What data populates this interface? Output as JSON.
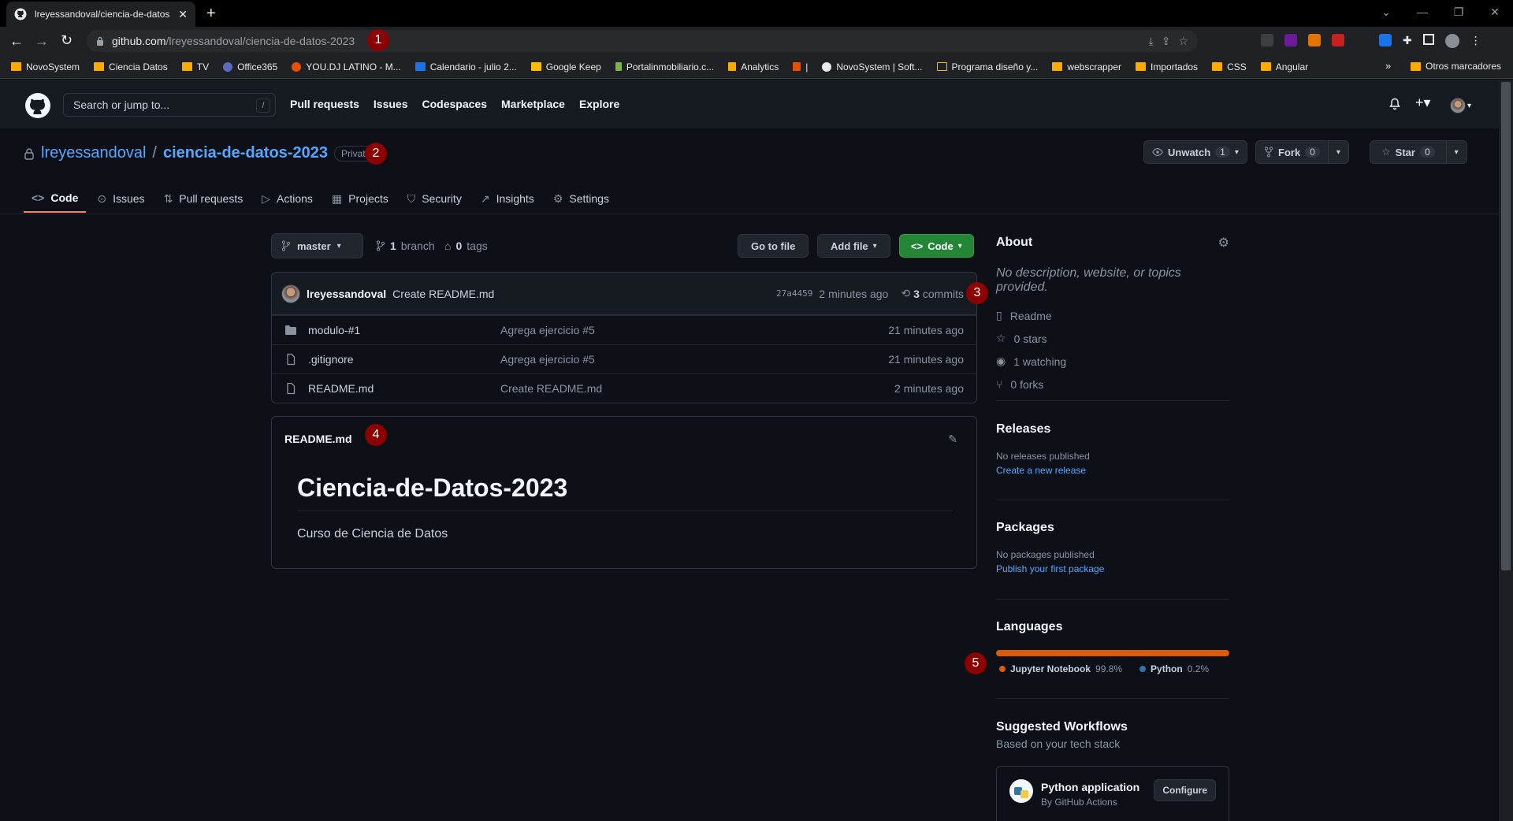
{
  "browser": {
    "tab_title": "lreyessandoval/ciencia-de-datos",
    "url_host": "github.com",
    "url_path": "/lreyessandoval/ciencia-de-datos-2023",
    "bookmarks": [
      "NovoSystem",
      "Ciencia Datos",
      "TV",
      "Office365",
      "YOU.DJ LATINO - M...",
      "Calendario - julio 2...",
      "Google Keep",
      "Portalinmobiliario.c...",
      "Analytics",
      "|",
      "NovoSystem | Soft...",
      "Programa diseño y...",
      "webscrapper",
      "Importados",
      "CSS",
      "Angular"
    ],
    "other_bookmarks": "Otros marcadores",
    "more_bookmarks": "»"
  },
  "gh": {
    "search_placeholder": "Search or jump to...",
    "search_key": "/",
    "nav": [
      "Pull requests",
      "Issues",
      "Codespaces",
      "Marketplace",
      "Explore"
    ]
  },
  "repo": {
    "owner": "lreyessandoval",
    "separator": "/",
    "name": "ciencia-de-datos-2023",
    "visibility": "Private",
    "unwatch_label": "Unwatch",
    "watch_count": "1",
    "fork_label": "Fork",
    "fork_count": "0",
    "star_label": "Star",
    "star_count": "0",
    "tabs": [
      "Code",
      "Issues",
      "Pull requests",
      "Actions",
      "Projects",
      "Security",
      "Insights",
      "Settings"
    ]
  },
  "code": {
    "branch": "master",
    "branch_count": "1",
    "branch_word": "branch",
    "tag_count": "0",
    "tag_word": "tags",
    "go_to_file": "Go to file",
    "add_file": "Add file",
    "code_btn": "Code",
    "commit_author": "lreyessandoval",
    "commit_msg": "Create README.md",
    "commit_hash": "27a4459",
    "commit_age": "2 minutes ago",
    "commit_count": "3",
    "commit_word": "commits",
    "files": [
      {
        "name": "modulo-#1",
        "type": "folder",
        "msg": "Agrega ejercicio #5",
        "age": "21 minutes ago"
      },
      {
        "name": ".gitignore",
        "type": "file",
        "msg": "Agrega ejercicio #5",
        "age": "21 minutes ago"
      },
      {
        "name": "README.md",
        "type": "file",
        "msg": "Create README.md",
        "age": "2 minutes ago"
      }
    ]
  },
  "readme": {
    "filename": "README.md",
    "heading": "Ciencia-de-Datos-2023",
    "body": "Curso de Ciencia de Datos"
  },
  "about": {
    "title": "About",
    "desc": "No description, website, or topics provided.",
    "items": [
      "Readme",
      "0 stars",
      "1 watching",
      "0 forks"
    ]
  },
  "releases": {
    "title": "Releases",
    "none": "No releases published",
    "link": "Create a new release"
  },
  "packages": {
    "title": "Packages",
    "none": "No packages published",
    "link": "Publish your first package"
  },
  "languages": {
    "title": "Languages",
    "items": [
      {
        "name": "Jupyter Notebook",
        "pct": "99.8%",
        "color": "#DA5B0B"
      },
      {
        "name": "Python",
        "pct": "0.2%",
        "color": "#3572A5"
      }
    ]
  },
  "workflows": {
    "title": "Suggested Workflows",
    "subtitle": "Based on your tech stack",
    "card_title": "Python application",
    "card_sub": "By GitHub Actions",
    "configure": "Configure"
  },
  "badges": [
    "1",
    "2",
    "3",
    "4",
    "5"
  ],
  "colors": {
    "accent_tab": "#f78166",
    "link": "#58a6ff",
    "green": "#238636",
    "badge": "#8b0000"
  }
}
